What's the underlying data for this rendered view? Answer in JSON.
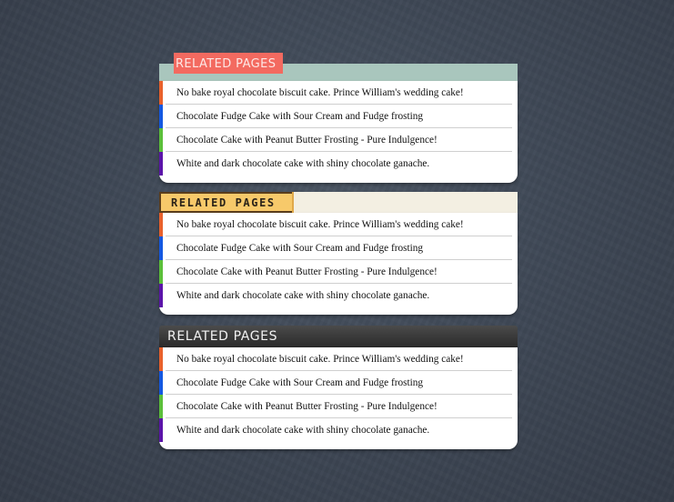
{
  "colors": {
    "bar_1": "#e8612c",
    "bar_2": "#1458e0",
    "bar_3": "#5bbf3a",
    "bar_4": "#5b14a8",
    "header_teal": "#a9c6bd",
    "tab_coral": "#f36a60",
    "tab_yellow": "#f7c96a",
    "header_dark": "#333333"
  },
  "widgets": [
    {
      "title": "RELATED PAGES",
      "style": "coral-tab",
      "items": [
        "No bake royal chocolate biscuit cake. Prince William's wedding cake!",
        "Chocolate Fudge Cake with Sour Cream and Fudge frosting",
        "Chocolate Cake with Peanut Butter Frosting - Pure Indulgence!",
        "White and dark chocolate cake with shiny chocolate ganache."
      ]
    },
    {
      "title": "RELATED PAGES",
      "style": "yellow-tab",
      "items": [
        "No bake royal chocolate biscuit cake. Prince William's wedding cake!",
        "Chocolate Fudge Cake with Sour Cream and Fudge frosting",
        "Chocolate Cake with Peanut Butter Frosting - Pure Indulgence!",
        "White and dark chocolate cake with shiny chocolate ganache."
      ]
    },
    {
      "title": "RELATED PAGES",
      "style": "dark-header",
      "items": [
        "No bake royal chocolate biscuit cake. Prince William's wedding cake!",
        "Chocolate Fudge Cake with Sour Cream and Fudge frosting",
        "Chocolate Cake with Peanut Butter Frosting - Pure Indulgence!",
        "White and dark chocolate cake with shiny chocolate ganache."
      ]
    }
  ]
}
